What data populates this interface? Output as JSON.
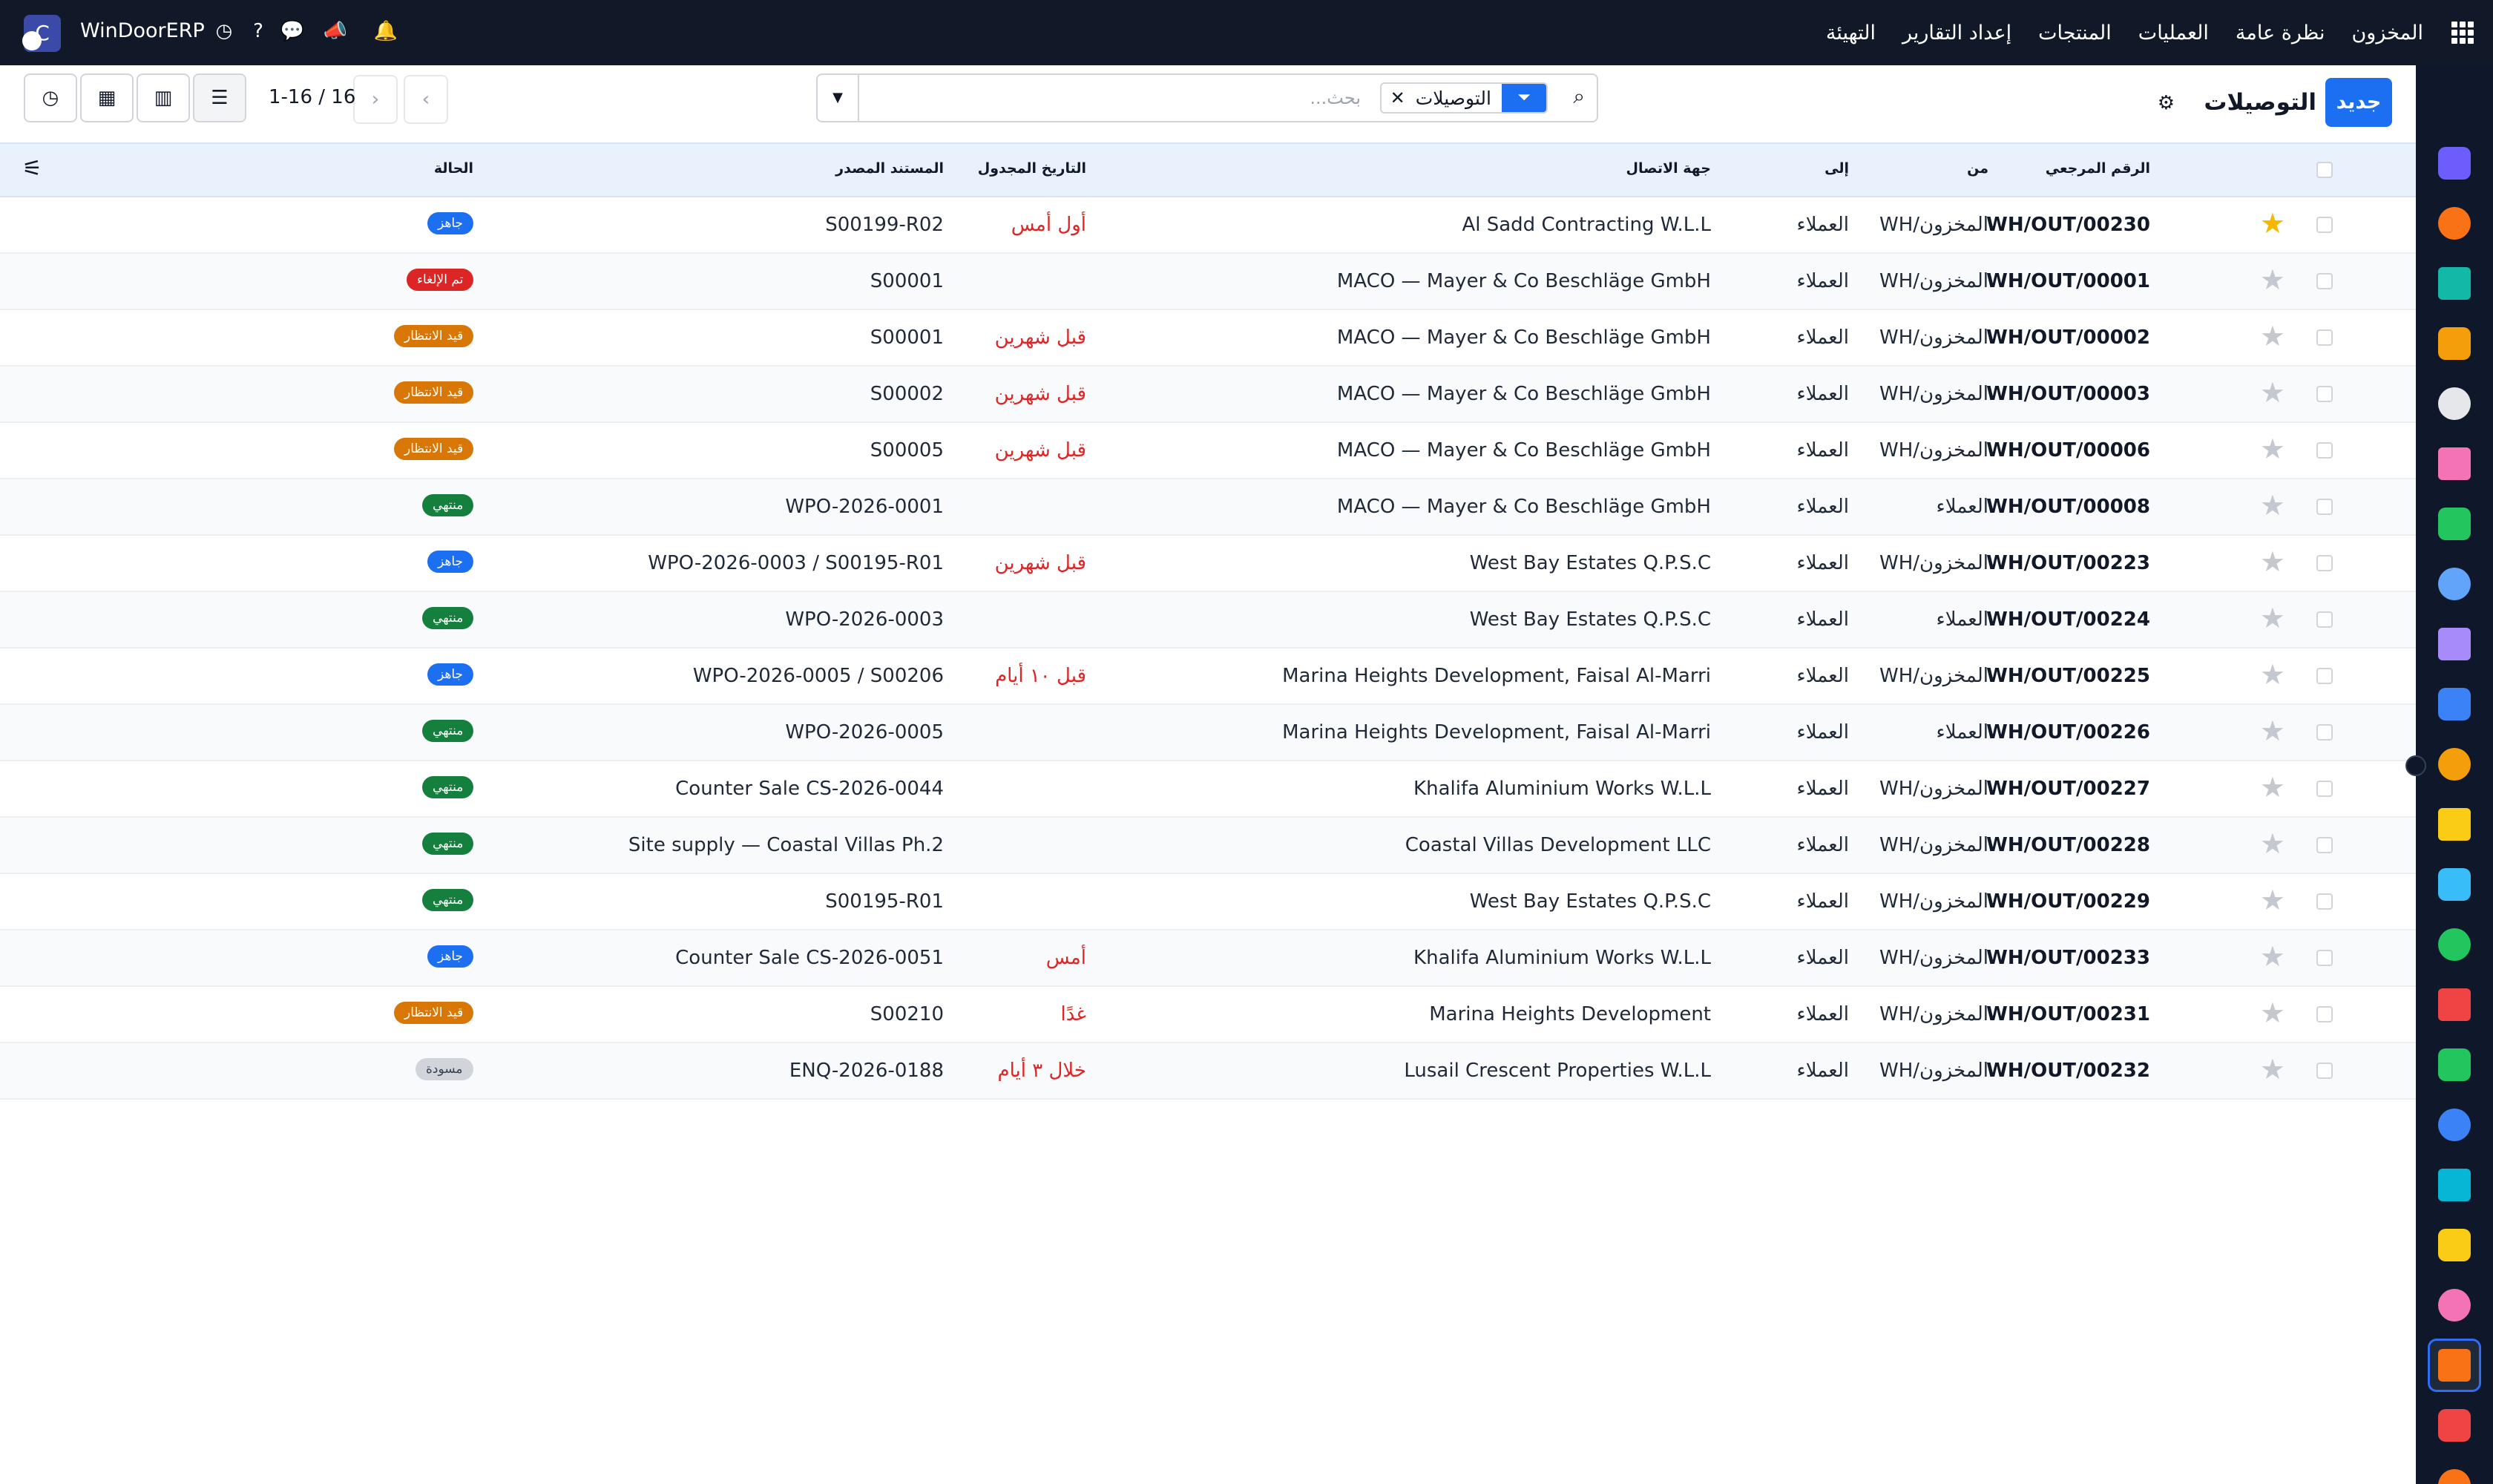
{
  "navbar": {
    "brand": "WinDoorERP",
    "logo_letter": "C",
    "menu": [
      "المخزون",
      "نظرة عامة",
      "العمليات",
      "المنتجات",
      "إعداد التقارير",
      "التهيئة"
    ],
    "icons": [
      "clock-icon",
      "help-icon",
      "chat-icon",
      "megaphone-icon",
      "bell-icon"
    ]
  },
  "control_panel": {
    "new_button": "جديد",
    "title": "التوصيلات",
    "search_placeholder": "بحث...",
    "facet_label": "التوصيلات",
    "pager": "1-16 / 16"
  },
  "table": {
    "headers": {
      "reference": "الرقم المرجعي",
      "from": "من",
      "to": "إلى",
      "contact": "جهة الاتصال",
      "scheduled": "التاريخ المجدول",
      "source": "المستند المصدر",
      "status": "الحالة"
    },
    "rows": [
      {
        "ref": "WH/OUT/00230",
        "from": "WH/المخزون",
        "to": "العملاء",
        "contact": "Al Sadd Contracting W.L.L",
        "date": "أول أمس",
        "source": "S00199-R02",
        "status": "جاهز",
        "status_color": "#1d6ff2",
        "starred": true
      },
      {
        "ref": "WH/OUT/00001",
        "from": "WH/المخزون",
        "to": "العملاء",
        "contact": "MACO — Mayer & Co Beschläge GmbH",
        "date": "",
        "source": "S00001",
        "status": "تم الإلغاء",
        "status_color": "#dc2626",
        "starred": false
      },
      {
        "ref": "WH/OUT/00002",
        "from": "WH/المخزون",
        "to": "العملاء",
        "contact": "MACO — Mayer & Co Beschläge GmbH",
        "date": "قبل شهرين",
        "source": "S00001",
        "status": "قيد الانتظار",
        "status_color": "#d97706",
        "starred": false
      },
      {
        "ref": "WH/OUT/00003",
        "from": "WH/المخزون",
        "to": "العملاء",
        "contact": "MACO — Mayer & Co Beschläge GmbH",
        "date": "قبل شهرين",
        "source": "S00002",
        "status": "قيد الانتظار",
        "status_color": "#d97706",
        "starred": false
      },
      {
        "ref": "WH/OUT/00006",
        "from": "WH/المخزون",
        "to": "العملاء",
        "contact": "MACO — Mayer & Co Beschläge GmbH",
        "date": "قبل شهرين",
        "source": "S00005",
        "status": "قيد الانتظار",
        "status_color": "#d97706",
        "starred": false
      },
      {
        "ref": "WH/OUT/00008",
        "from": "العملاء",
        "to": "العملاء",
        "contact": "MACO — Mayer & Co Beschläge GmbH",
        "date": "",
        "source": "WPO-2026-0001",
        "status": "منتهي",
        "status_color": "#15803d",
        "starred": false
      },
      {
        "ref": "WH/OUT/00223",
        "from": "WH/المخزون",
        "to": "العملاء",
        "contact": "West Bay Estates Q.P.S.C",
        "date": "قبل شهرين",
        "source": "WPO-2026-0003 / S00195-R01",
        "status": "جاهز",
        "status_color": "#1d6ff2",
        "starred": false
      },
      {
        "ref": "WH/OUT/00224",
        "from": "العملاء",
        "to": "العملاء",
        "contact": "West Bay Estates Q.P.S.C",
        "date": "",
        "source": "WPO-2026-0003",
        "status": "منتهي",
        "status_color": "#15803d",
        "starred": false
      },
      {
        "ref": "WH/OUT/00225",
        "from": "WH/المخزون",
        "to": "العملاء",
        "contact": "Marina Heights Development, Faisal Al-Marri",
        "date": "قبل ١٠ أيام",
        "source": "WPO-2026-0005 / S00206",
        "status": "جاهز",
        "status_color": "#1d6ff2",
        "starred": false
      },
      {
        "ref": "WH/OUT/00226",
        "from": "العملاء",
        "to": "العملاء",
        "contact": "Marina Heights Development, Faisal Al-Marri",
        "date": "",
        "source": "WPO-2026-0005",
        "status": "منتهي",
        "status_color": "#15803d",
        "starred": false
      },
      {
        "ref": "WH/OUT/00227",
        "from": "WH/المخزون",
        "to": "العملاء",
        "contact": "Khalifa Aluminium Works W.L.L",
        "date": "",
        "source": "Counter Sale CS-2026-0044",
        "status": "منتهي",
        "status_color": "#15803d",
        "starred": false
      },
      {
        "ref": "WH/OUT/00228",
        "from": "WH/المخزون",
        "to": "العملاء",
        "contact": "Coastal Villas Development LLC",
        "date": "",
        "source": "Site supply — Coastal Villas Ph.2",
        "status": "منتهي",
        "status_color": "#15803d",
        "starred": false
      },
      {
        "ref": "WH/OUT/00229",
        "from": "WH/المخزون",
        "to": "العملاء",
        "contact": "West Bay Estates Q.P.S.C",
        "date": "",
        "source": "S00195-R01",
        "status": "منتهي",
        "status_color": "#15803d",
        "starred": false
      },
      {
        "ref": "WH/OUT/00233",
        "from": "WH/المخزون",
        "to": "العملاء",
        "contact": "Khalifa Aluminium Works W.L.L",
        "date": "أمس",
        "source": "Counter Sale CS-2026-0051",
        "status": "جاهز",
        "status_color": "#1d6ff2",
        "starred": false
      },
      {
        "ref": "WH/OUT/00231",
        "from": "WH/المخزون",
        "to": "العملاء",
        "contact": "Marina Heights Development",
        "date": "غدًا",
        "source": "S00210",
        "status": "قيد الانتظار",
        "status_color": "#d97706",
        "starred": false
      },
      {
        "ref": "WH/OUT/00232",
        "from": "WH/المخزون",
        "to": "العملاء",
        "contact": "Lusail Crescent Properties W.L.L",
        "date": "خلال ٣ أيام",
        "source": "ENQ-2026-0188",
        "status": "مسودة",
        "status_color": "#d1d5db",
        "starred": false
      }
    ]
  },
  "app_rail": {
    "apps": [
      {
        "name": "mail-app-icon",
        "color": "#6d5dfc"
      },
      {
        "name": "discuss-app-icon",
        "color": "#f97316"
      },
      {
        "name": "crm-app-icon",
        "color": "#14b8a6"
      },
      {
        "name": "reports-app-icon",
        "color": "#f59e0b"
      },
      {
        "name": "cube-app-icon",
        "color": "#e5e7eb"
      },
      {
        "name": "gallery-app-icon",
        "color": "#f472b6"
      },
      {
        "name": "tasks-app-icon",
        "color": "#22c55e"
      },
      {
        "name": "book-app-icon",
        "color": "#60a5fa"
      },
      {
        "name": "box-app-icon",
        "color": "#a78bfa"
      },
      {
        "name": "sheet-app-icon",
        "color": "#3b82f6"
      },
      {
        "name": "people-app-icon",
        "color": "#f59e0b"
      },
      {
        "name": "calendar-app-icon",
        "color": "#facc15"
      },
      {
        "name": "sign-app-icon",
        "color": "#38bdf8"
      },
      {
        "name": "contact-app-icon",
        "color": "#22c55e"
      },
      {
        "name": "dashboard-app-icon",
        "color": "#ef4444"
      },
      {
        "name": "whatsapp-app-icon",
        "color": "#22c55e"
      },
      {
        "name": "time-app-icon",
        "color": "#3b82f6"
      },
      {
        "name": "wave-app-icon",
        "color": "#06b6d4"
      },
      {
        "name": "send-app-icon",
        "color": "#facc15"
      },
      {
        "name": "layers-app-icon",
        "color": "#f472b6"
      },
      {
        "name": "inventory-app-icon",
        "color": "#f97316"
      },
      {
        "name": "pie-app-icon",
        "color": "#ef4444"
      },
      {
        "name": "hex-app-icon",
        "color": "#f97316"
      }
    ]
  }
}
